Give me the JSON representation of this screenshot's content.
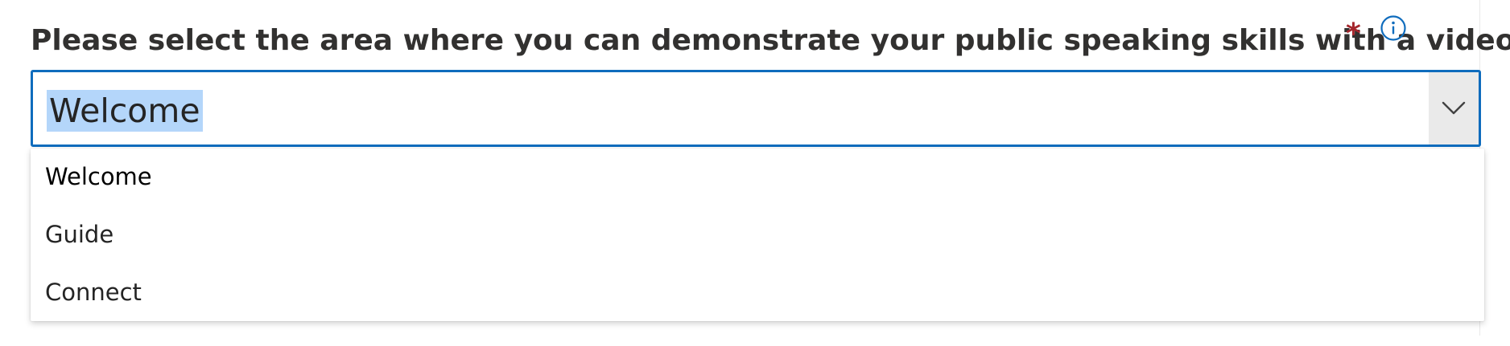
{
  "question": {
    "title": "Please select the area where you can demonstrate your public speaking skills with a video",
    "required_mark": "*",
    "info_icon": "info-icon"
  },
  "select": {
    "selected_value": "Welcome",
    "chevron_icon": "chevron-down-icon",
    "focus_border_color": "#0f6cbd",
    "highlight_color": "#b4d6fa"
  },
  "options": [
    {
      "label": "Welcome",
      "selected": true
    },
    {
      "label": "Guide",
      "selected": false
    },
    {
      "label": "Connect",
      "selected": false
    }
  ],
  "colors": {
    "required": "#a4262c",
    "accent": "#0f6cbd"
  }
}
